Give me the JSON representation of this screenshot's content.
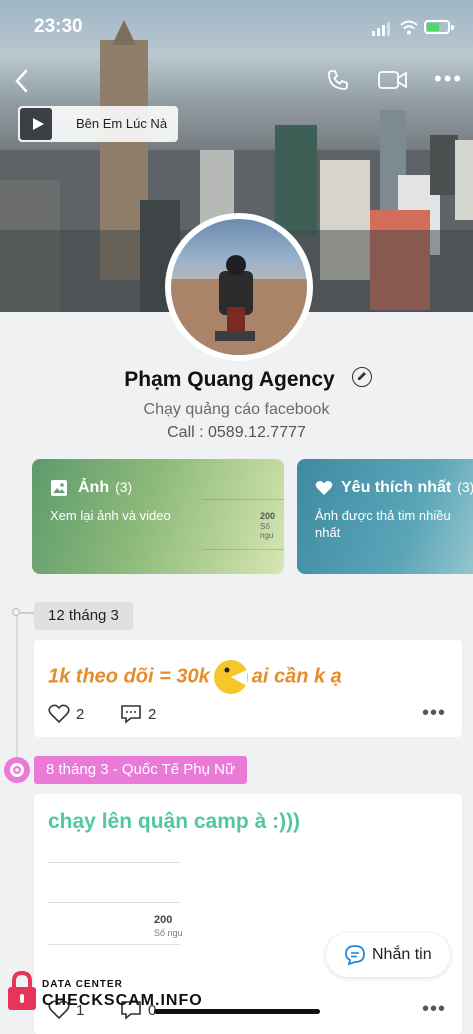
{
  "status": {
    "time": "23:30"
  },
  "cover": {
    "music_title": "Bên Em Lúc Nà"
  },
  "profile": {
    "name": "Phạm Quang Agency",
    "bio_line1": "Chạy quảng cáo facebook",
    "bio_line2": "Call : 0589.12.7777"
  },
  "cards": [
    {
      "title": "Ảnh",
      "count": "(3)",
      "subtitle": "Xem lại ảnh và video",
      "chart_value": "200",
      "chart_label": "Số ngu"
    },
    {
      "title": "Yêu thích nhất",
      "count": "(3)",
      "subtitle": "Ảnh được thả tim nhiều nhất"
    }
  ],
  "timeline": {
    "date1": "12 tháng 3",
    "post1": {
      "text_before": "1k theo dõi = 30k",
      "text_after": "ai cần k ạ",
      "likes": "2",
      "comments": "2"
    },
    "date2": "8 tháng 3 - Quốc Tế Phụ Nữ",
    "post2": {
      "text": "chạy lên quận camp à :)))",
      "chart_value": "200",
      "chart_label": "Số ngu",
      "likes": "1",
      "comments": "0"
    }
  },
  "fab": {
    "label": "Nhắn tin"
  },
  "watermark": {
    "line1": "DATA CENTER",
    "line2": "CHECKSCAM.INFO"
  },
  "colors": {
    "accent_orange": "#e78c2a",
    "accent_teal": "#52c7a4",
    "holiday_pink": "#e97ad8"
  }
}
